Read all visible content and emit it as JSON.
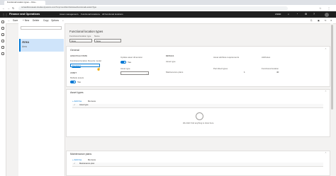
{
  "browser": {
    "tab_title": "Functional location types -- Fina...",
    "url": "ocrsandboxuseast.cloudax.dynamics.com/?cmp=usmf&mi=EntAssetFunctionalLocationType"
  },
  "header": {
    "app_name": "Finance and Operations",
    "breadcrumb": [
      "Asset management",
      "Functional locations",
      "All functional locations"
    ],
    "company": "USMF"
  },
  "toolbar": {
    "save": "Save",
    "new": "+ New",
    "delete": "Delete",
    "copy": "Copy",
    "options": "Options"
  },
  "list": {
    "items": [
      {
        "title": "Area",
        "subtitle": "Area"
      }
    ]
  },
  "form": {
    "page_title": "Functional location types",
    "type_label": "Functional location type",
    "type_value": "Area",
    "name_label": "Name",
    "name_value": "Area",
    "general": {
      "title": "General",
      "lifecycle_section": "LIFECYCLE STATE",
      "lifecycle_model_label": "Functional location lifecycle model",
      "lifecycle_model_value": "Standard",
      "update_label": "Update asset dimension",
      "update_value": "Yes",
      "asset_section": "ASSET",
      "multiple_assets_label": "Multiple assets",
      "multiple_assets_value": "Yes",
      "asset_type_label": "Asset type",
      "details_section": "DETAILS",
      "asset_type_col": "Asset type",
      "maintenance_plans_col": "Maintenance plans",
      "asset_attr_req": "Asset attribute requirements",
      "permitted_types": "Permitted types",
      "permitted_value": "1",
      "attributes": "Attributes",
      "func_location": "Functional location",
      "func_location_value": "40"
    },
    "asset_types": {
      "title": "Asset types",
      "add": "+ Add line",
      "remove": "Remove",
      "column": "Asset type",
      "empty_text": "We didn't find anything to show here."
    },
    "maint_plans": {
      "title": "Maintenance plans",
      "add": "+ Add line",
      "remove": "Remove",
      "column": "Maintenance plan"
    }
  }
}
